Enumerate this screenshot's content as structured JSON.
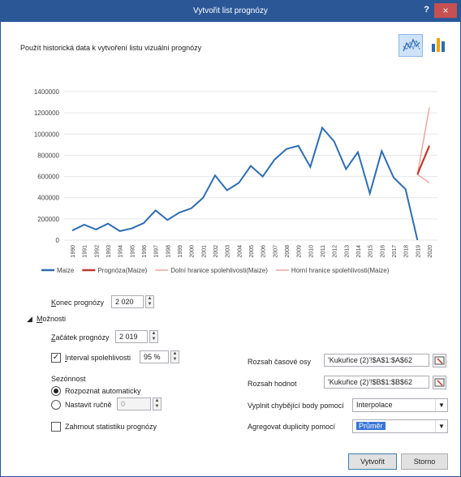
{
  "window": {
    "title": "Vytvořit list prognózy",
    "help": "?",
    "close": "×"
  },
  "heading": "Použít historická data k vytvoření listu vizuální prognózy",
  "chart_data": {
    "type": "line",
    "x": [
      "1990",
      "1991",
      "1992",
      "1993",
      "1994",
      "1995",
      "1996",
      "1997",
      "1998",
      "1999",
      "2000",
      "2001",
      "2002",
      "2003",
      "2004",
      "2005",
      "2006",
      "2007",
      "2008",
      "2009",
      "2010",
      "2011",
      "2012",
      "2013",
      "2014",
      "2015",
      "2016",
      "2017",
      "2018",
      "2019",
      "2020"
    ],
    "ylim": [
      0,
      1400000
    ],
    "yticks": [
      "0",
      "200000",
      "400000",
      "600000",
      "800000",
      "1000000",
      "1200000",
      "1400000"
    ],
    "series": [
      {
        "name": "Maize",
        "color": "#2e6db3",
        "x_start": 0,
        "values": [
          90000,
          145000,
          100000,
          155000,
          85000,
          110000,
          160000,
          280000,
          190000,
          260000,
          300000,
          400000,
          610000,
          470000,
          540000,
          700000,
          600000,
          760000,
          860000,
          890000,
          690000,
          1060000,
          930000,
          670000,
          830000,
          440000,
          840000,
          590000,
          480000,
          620
        ]
      },
      {
        "name": "Prognóza(Maize)",
        "color": "#c0392b",
        "x_start": 29,
        "values": [
          620000,
          890000
        ]
      },
      {
        "name": "Dolní hranice spolehlivosti(Maize)",
        "color": "#e8958f",
        "x_start": 29,
        "values": [
          620000,
          540000
        ]
      },
      {
        "name": "Horní hranice spolehlivosti(Maize)",
        "color": "#e8958f",
        "x_start": 29,
        "values": [
          620000,
          1250000
        ]
      }
    ]
  },
  "forecast_end": {
    "label_pre": "K",
    "label_post": "onec prognózy",
    "value": "2 020"
  },
  "options": {
    "label_pre": "M",
    "label_post": "ožnosti"
  },
  "forecast_start": {
    "label_pre": "Z",
    "label_post": "ačátek prognózy",
    "value": "2 019"
  },
  "confidence": {
    "label_pre": "I",
    "label_post": "nterval spolehlivosti",
    "value": "95 %",
    "checked": true
  },
  "seasonality": {
    "label": "Sezónnost",
    "auto_label": "Rozpoznat automaticky",
    "manual_label": "Nastavit ručně",
    "manual_value": "0"
  },
  "include_stats": {
    "label": "Zahrnout statistiku prognózy",
    "checked": false
  },
  "timeline_range": {
    "label": "Rozsah časové osy",
    "value": "'Kukuřice (2)'!$A$1:$A$62"
  },
  "values_range": {
    "label": "Rozsah hodnot",
    "value": "'Kukuřice (2)'!$B$1:$B$62"
  },
  "fill_missing": {
    "label": "Vyplnit chybějící body pomocí",
    "value": "Interpolace"
  },
  "aggregate": {
    "label": "Agregovat duplicity pomocí",
    "value": "Průměr"
  },
  "buttons": {
    "create": "Vytvořit",
    "cancel": "Storno"
  },
  "icons": {
    "line_chart": "line-chart-icon",
    "bar_chart": "column-chart-icon",
    "range": "range-select-icon"
  }
}
